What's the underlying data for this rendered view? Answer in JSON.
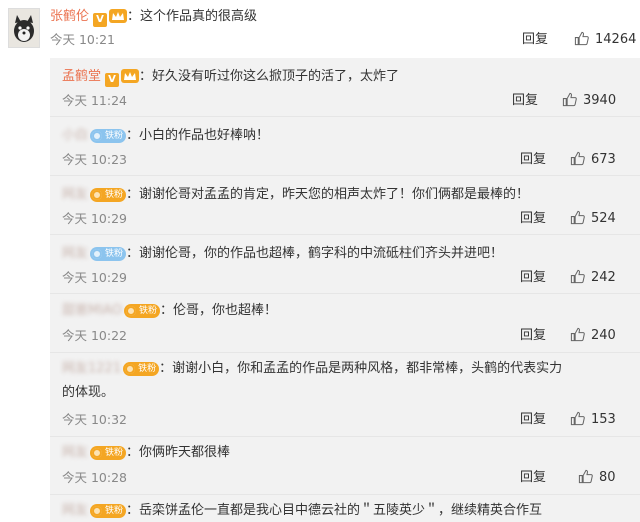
{
  "main_comment": {
    "username": "张鹤伦",
    "text": "：这个作品真的很高级",
    "time": "今天 10:21",
    "reply_label": "回复",
    "likes": "14264",
    "avatar_icon": "dog-avatar",
    "verified_icon": "v-badge",
    "crown_icon": "crown-icon"
  },
  "replies": [
    {
      "username": "孟鹤堂",
      "verified": true,
      "badge_label": "",
      "text": "：好久没有听过你这么掀顶子的活了，太炸了",
      "time": "今天 11:24",
      "reply_label": "回复",
      "likes": "3940"
    },
    {
      "username": "小白",
      "badge_label": "铁粉",
      "badge_color": "#8cc4ee",
      "text": "：小白的作品也好棒呐！",
      "time": "今天 10:23",
      "reply_label": "回复",
      "likes": "673"
    },
    {
      "username": "网友",
      "badge_label": "铁粉",
      "badge_color": "#f4a623",
      "text": "：谢谢伦哥对孟孟的肯定，昨天您的相声太炸了！你们俩都是最棒的！",
      "time": "今天 10:29",
      "reply_label": "回复",
      "likes": "524"
    },
    {
      "username": "网友",
      "badge_label": "铁粉",
      "badge_color": "#8cc4ee",
      "text": "：谢谢伦哥，你的作品也超棒，鹤字科的中流砥柱们齐头并进吧！",
      "time": "今天 10:29",
      "reply_label": "回复",
      "likes": "242"
    },
    {
      "username": "甜崽MIAO",
      "badge_label": "铁粉",
      "badge_color": "#f4a623",
      "text": "：伦哥，你也超棒！",
      "time": "今天 10:22",
      "reply_label": "回复",
      "likes": "240"
    },
    {
      "username": "网友1221",
      "badge_label": "铁粉",
      "badge_color": "#f4a623",
      "text": "：谢谢小白，你和孟孟的作品是两种风格，都非常棒，头鹤的代表实力",
      "text2": "的体现。",
      "time": "今天 10:32",
      "reply_label": "回复",
      "likes": "153"
    },
    {
      "username": "网友",
      "badge_label": "铁粉",
      "badge_color": "#f4a623",
      "text": "：你俩昨天都很棒",
      "time": "今天 10:28",
      "reply_label": "回复",
      "likes": "80"
    },
    {
      "username": "网友",
      "badge_label": "铁粉",
      "badge_color": "#f4a623",
      "text": "：岳栾饼孟伦一直都是我心目中德云社的＂五陵英少＂，继续精英合作互",
      "time": "",
      "reply_label": "",
      "likes": ""
    }
  ],
  "colors": {
    "username": "#eb7350",
    "reply_bg": "#f2f2f2",
    "gold": "#f4a623",
    "blue": "#8cc4ee"
  }
}
